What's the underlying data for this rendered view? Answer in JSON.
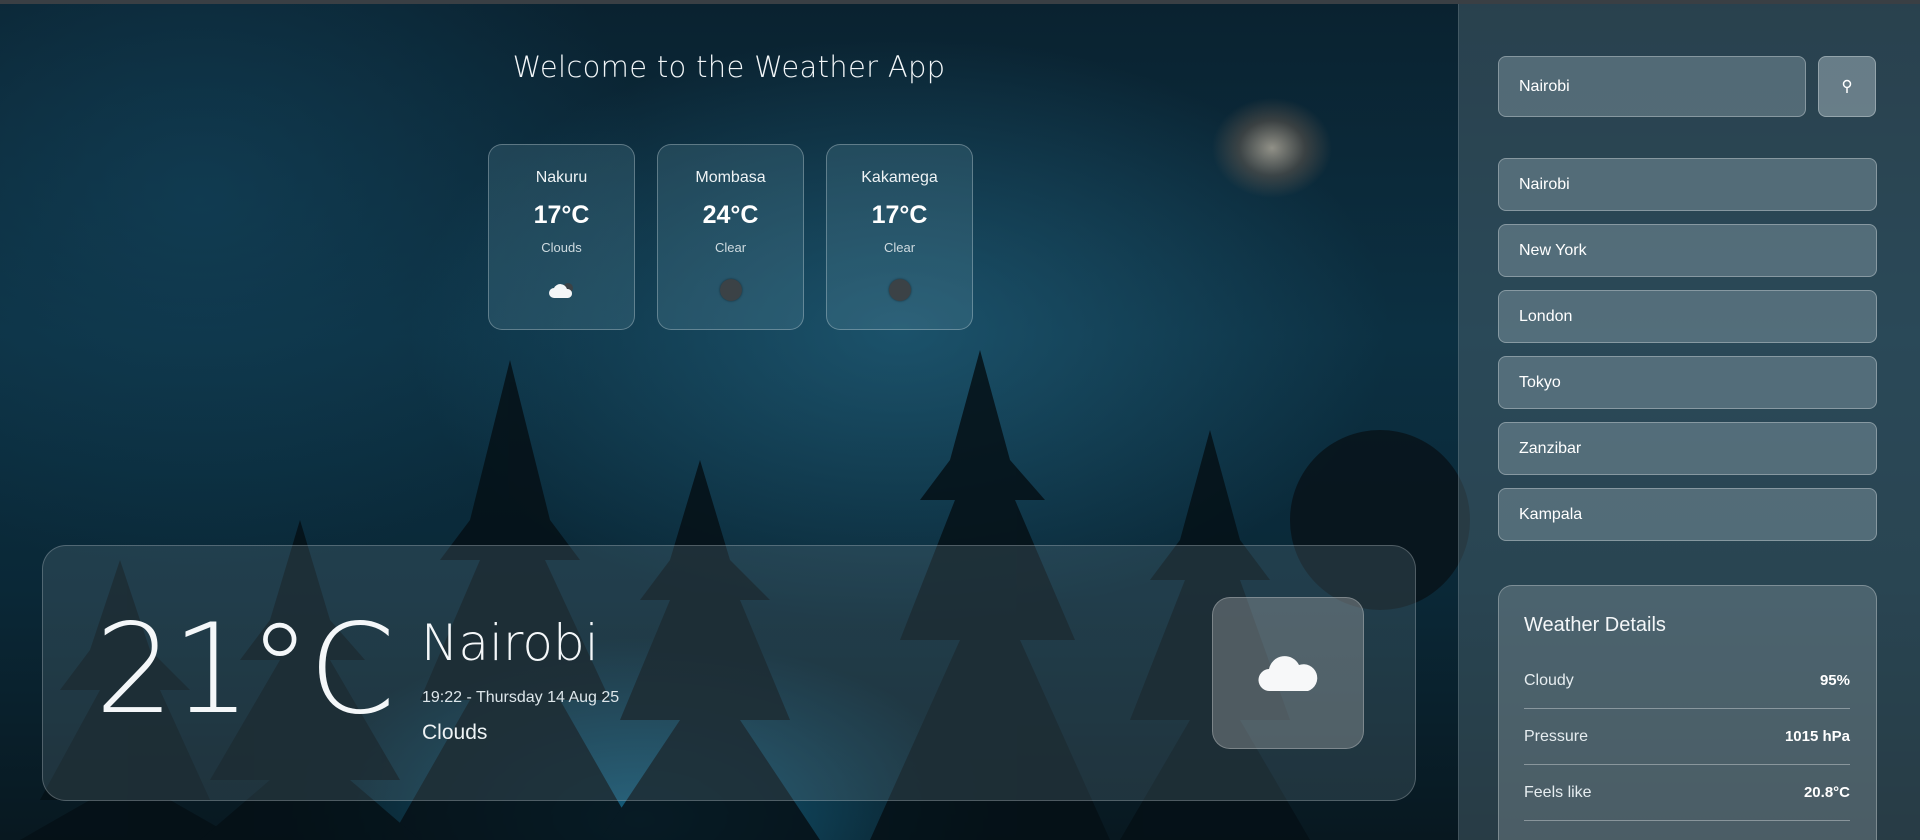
{
  "app": {
    "title": "Welcome to the Weather App"
  },
  "city_cards": [
    {
      "name": "Nakuru",
      "temp": "17°C",
      "condition": "Clouds",
      "icon": "cloud-icon"
    },
    {
      "name": "Mombasa",
      "temp": "24°C",
      "condition": "Clear",
      "icon": "clear-night-icon"
    },
    {
      "name": "Kakamega",
      "temp": "17°C",
      "condition": "Clear",
      "icon": "clear-night-icon"
    }
  ],
  "current": {
    "temp": "21°C",
    "city": "Nairobi",
    "datetime": "19:22 - Thursday 14 Aug 25",
    "condition": "Clouds",
    "icon": "cloud-icon"
  },
  "sidebar": {
    "search": {
      "value": "Nairobi",
      "placeholder": "Nairobi",
      "button_icon": "search-pin-icon"
    },
    "cities": [
      {
        "label": "Nairobi"
      },
      {
        "label": "New York"
      },
      {
        "label": "London"
      },
      {
        "label": "Tokyo"
      },
      {
        "label": "Zanzibar"
      },
      {
        "label": "Kampala"
      }
    ],
    "details": {
      "title": "Weather Details",
      "rows": [
        {
          "label": "Cloudy",
          "value": "95%"
        },
        {
          "label": "Pressure",
          "value": "1015 hPa"
        },
        {
          "label": "Feels like",
          "value": "20.8°C"
        }
      ]
    }
  },
  "colors": {
    "background": "#0c3042",
    "card_glass": "#78aabe",
    "text": "#ffffff"
  }
}
